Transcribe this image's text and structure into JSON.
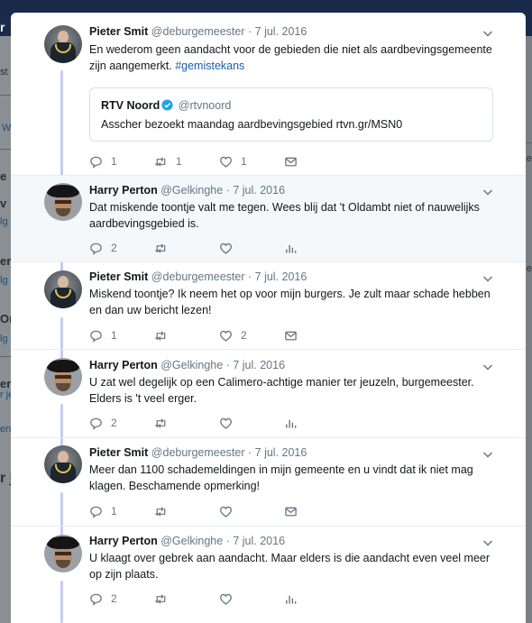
{
  "background": {
    "fragments": [
      "r",
      "st",
      "W",
      "e",
      "v",
      "lg",
      "er",
      "lg",
      "Or",
      "lg",
      "en",
      "r je",
      "en",
      "r j"
    ]
  },
  "tweets": [
    {
      "author": "Pieter Smit",
      "handle": "@deburgemeester",
      "date": "7 jul. 2016",
      "text": "En wederom geen aandacht voor de gebieden die niet als aardbevingsgemeente zijn aangemerkt. ",
      "hashtag": "#gemistekans",
      "quote": {
        "author": "RTV Noord",
        "handle": "@rtvnoord",
        "text": "Asscher bezoekt maandag aardbevingsgebied rtvn.gr/MSN0"
      },
      "actions": {
        "replies": "1",
        "retweets": "1",
        "likes": "1",
        "last_icon": "mail-icon"
      }
    },
    {
      "author": "Harry Perton",
      "handle": "@Gelkinghe",
      "date": "7 jul. 2016",
      "text": "Dat miskende toontje valt me tegen. Wees blij dat 't Oldambt niet of nauwelijks aardbevingsgebied is.",
      "actions": {
        "replies": "2",
        "retweets": "",
        "likes": "",
        "last_icon": "analytics-icon"
      }
    },
    {
      "author": "Pieter Smit",
      "handle": "@deburgemeester",
      "date": "7 jul. 2016",
      "text": "Miskend toontje? Ik neem het op voor mijn burgers. Je zult maar schade hebben en dan uw bericht lezen!",
      "actions": {
        "replies": "1",
        "retweets": "",
        "likes": "2",
        "last_icon": "mail-icon"
      }
    },
    {
      "author": "Harry Perton",
      "handle": "@Gelkinghe",
      "date": "7 jul. 2016",
      "text": "U zat wel degelijk op een Calimero-achtige manier ter jeuzeln, burgemeester. Elders is 't veel erger.",
      "actions": {
        "replies": "2",
        "retweets": "",
        "likes": "",
        "last_icon": "analytics-icon"
      }
    },
    {
      "author": "Pieter Smit",
      "handle": "@deburgemeester",
      "date": "7 jul. 2016",
      "text": "Meer dan 1100 schademeldingen in mijn gemeente en u vindt dat ik niet mag klagen. Beschamende opmerking!",
      "actions": {
        "replies": "1",
        "retweets": "",
        "likes": "",
        "last_icon": "mail-icon"
      }
    },
    {
      "author": "Harry Perton",
      "handle": "@Gelkinghe",
      "date": "7 jul. 2016",
      "text": "U klaagt over gebrek aan aandacht.  Maar elders is die aandacht even veel meer op zijn plaats.",
      "actions": {
        "replies": "2",
        "retweets": "",
        "likes": "",
        "last_icon": "analytics-icon"
      }
    }
  ],
  "separator": "·",
  "colors": {
    "accent": "#1da1f2",
    "hashtag": "#1b5fa8",
    "text": "#14171a",
    "muted": "#657786",
    "thread_line": "#c5cdef",
    "highlight_bg": "#f5f8fa"
  }
}
